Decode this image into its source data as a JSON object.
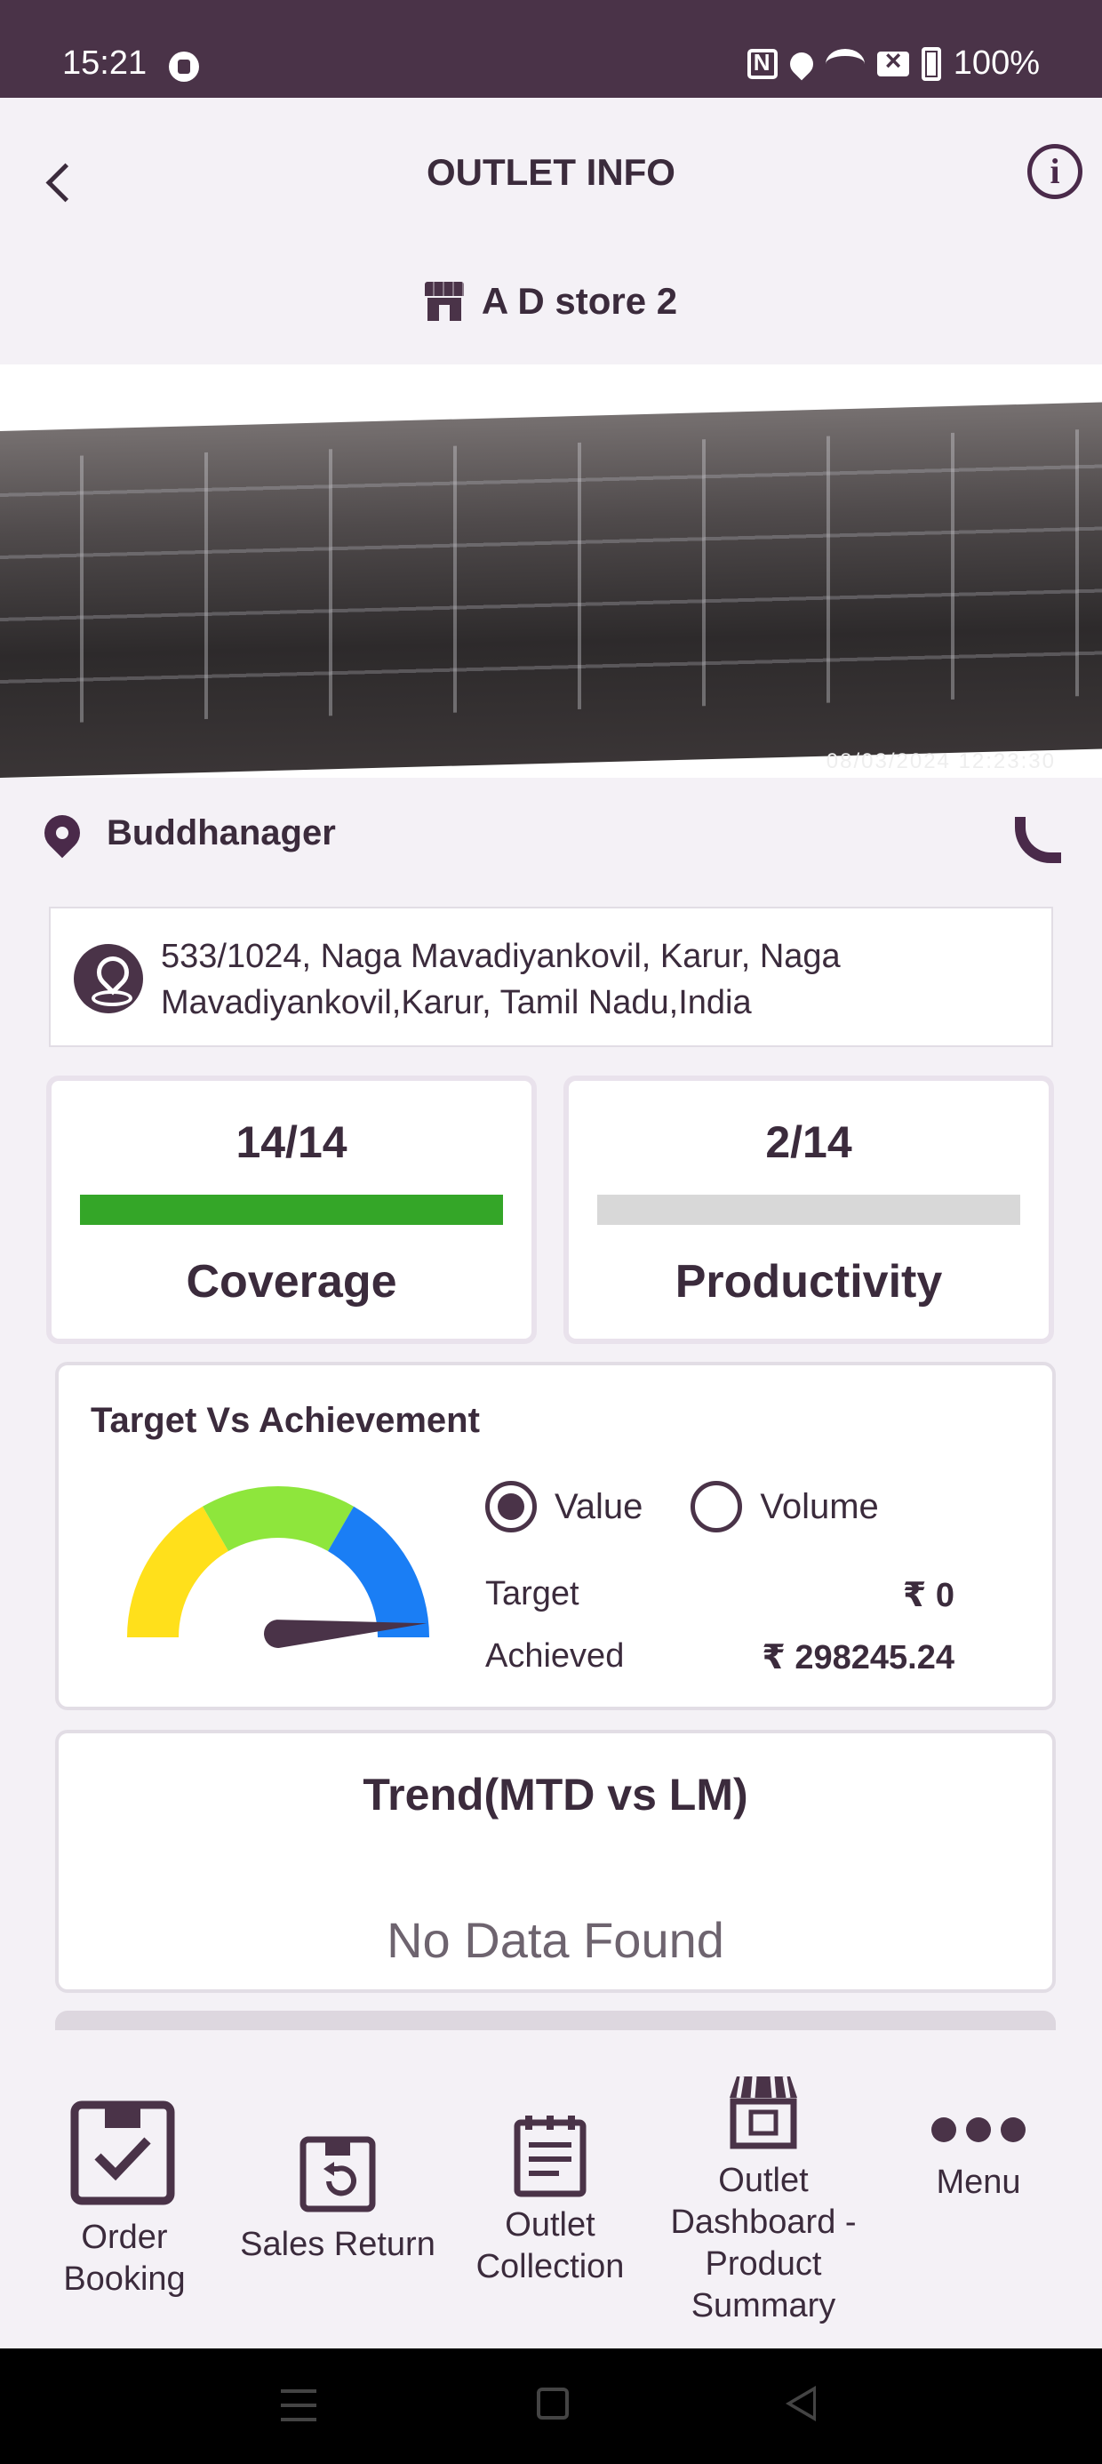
{
  "status_bar": {
    "time": "15:21",
    "battery": "100%",
    "icons": [
      "lock-icon",
      "nfc-icon",
      "location-icon",
      "wifi-icon",
      "no-sim-icon",
      "battery-icon"
    ]
  },
  "header": {
    "title": "OUTLET INFO",
    "store_name": "A D store 2",
    "icons": [
      "back-arrow-icon",
      "info-icon",
      "store-icon"
    ]
  },
  "photo": {
    "timestamp": "08/03/2024 12:23:30"
  },
  "location": {
    "name": "Buddhanager",
    "address": "533/1024, Naga Mavadiyankovil, Karur, Naga Mavadiyankovil,Karur, Tamil Nadu,India"
  },
  "metrics": {
    "coverage": {
      "value": "14/14",
      "label": "Coverage",
      "progress": 1.0,
      "color": "#34a628"
    },
    "productivity": {
      "value": "2/14",
      "label": "Productivity",
      "progress": 0.0,
      "color": "#d8d8d8"
    }
  },
  "target_vs_achievement": {
    "title": "Target Vs Achievement",
    "options": [
      {
        "label": "Value",
        "selected": true
      },
      {
        "label": "Volume",
        "selected": false
      }
    ],
    "target_label": "Target",
    "target_value": "₹ 0",
    "achieved_label": "Achieved",
    "achieved_value": "₹ 298245.24",
    "gauge_colors": [
      "#ffe01b",
      "#8ee63c",
      "#1a7ef5"
    ],
    "gauge_needle_fraction": 0.97
  },
  "trend": {
    "title": "Trend(MTD vs LM)",
    "empty_text": "No Data Found"
  },
  "bottom_nav": {
    "order_booking": "Order Booking",
    "sales_return": "Sales Return",
    "outlet_collection": "Outlet Collection",
    "outlet_dashboard": "Outlet Dashboard -Product Summary",
    "menu": "Menu"
  },
  "accent_color": "#4a3348"
}
